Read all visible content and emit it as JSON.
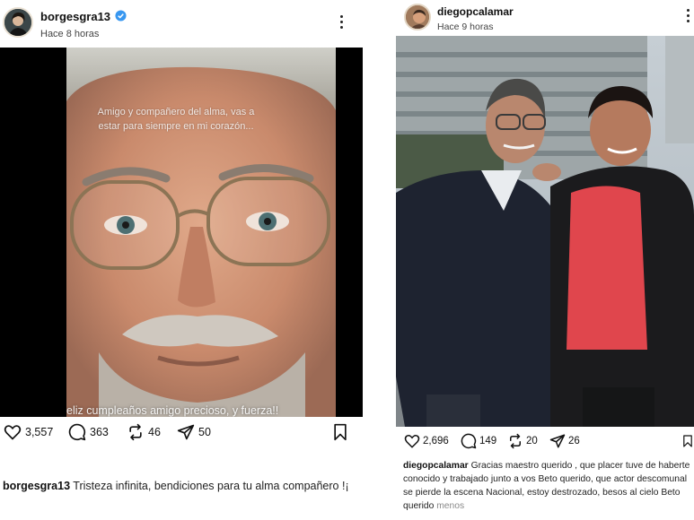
{
  "left_post": {
    "username": "borgesgra13",
    "timestamp": "Hace 8 horas",
    "overlay_text": "Amigo y compañero del alma, vas a estar para siempre en mi corazón...",
    "overlay_bottom": "eliz cumpleaños amigo precioso, y fuerza!!",
    "likes": "3,557",
    "comments": "363",
    "reposts": "46",
    "shares": "50",
    "caption_user": "borgesgra13",
    "caption_text": "Tristeza infinita, bendiciones para tu alma compañero !¡"
  },
  "right_post": {
    "username": "diegopcalamar",
    "timestamp": "Hace 9 horas",
    "likes": "2,696",
    "comments": "149",
    "reposts": "20",
    "shares": "26",
    "caption_user": "diegopcalamar",
    "caption_text": "Gracias maestro querido , que placer tuve de haberte conocido y trabajado junto a vos Beto querido, que actor descomunal se pierde la escena Nacional, estoy destrozado, besos al cielo Beto querido",
    "caption_more": "menos"
  },
  "colors": {
    "verified": "#3897f0",
    "red_shirt": "#e0464d",
    "muted_text": "#8a8a8a"
  },
  "icons": [
    "verified-icon",
    "more-options-icon",
    "heart-icon",
    "comment-icon",
    "repost-icon",
    "share-icon",
    "bookmark-icon"
  ]
}
